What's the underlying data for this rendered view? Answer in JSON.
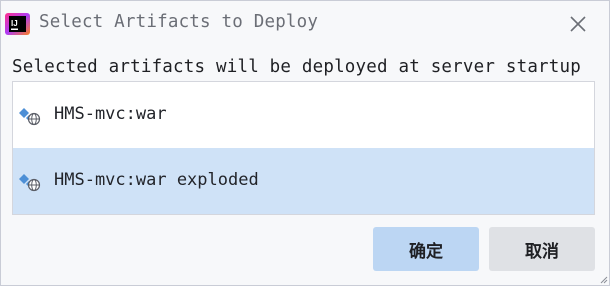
{
  "window": {
    "title": "Select Artifacts to Deploy",
    "app_icon": "intellij-idea-icon",
    "app_icon_text": "IJ",
    "close_icon": "close-icon"
  },
  "subtitle": "Selected artifacts will be deployed at server startup",
  "artifacts": [
    {
      "label": "HMS-mvc:war",
      "icon": "artifact-web-icon",
      "selected": false
    },
    {
      "label": "HMS-mvc:war exploded",
      "icon": "artifact-web-icon",
      "selected": true
    }
  ],
  "buttons": {
    "ok_label": "确定",
    "cancel_label": "取消"
  },
  "colors": {
    "selection": "#cfe2f7",
    "ok_button": "#bcd6f3",
    "cancel_button": "#dfe1e5",
    "dialog_bg": "#f7f8fa"
  }
}
